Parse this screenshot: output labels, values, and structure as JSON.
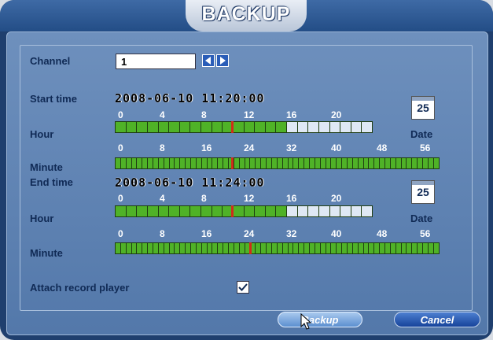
{
  "window": {
    "title": "BACKUP"
  },
  "channel": {
    "label": "Channel",
    "value": "1"
  },
  "start": {
    "label": "Start time",
    "datetime": "2008-06-10  11:20:00",
    "hour_label": "Hour",
    "minute_label": "Minute",
    "date_label": "Date",
    "date_day": "25",
    "hour_value": 11,
    "minute_value": 20
  },
  "end": {
    "label": "End time",
    "datetime": "2008-06-10  11:24:00",
    "hour_label": "Hour",
    "minute_label": "Minute",
    "date_label": "Date",
    "date_day": "25",
    "hour_value": 11,
    "minute_value": 24
  },
  "hour_scale": [
    "0",
    "4",
    "8",
    "12",
    "16",
    "20"
  ],
  "minute_scale": [
    "0",
    "8",
    "16",
    "24",
    "32",
    "40",
    "48",
    "56"
  ],
  "hour_segments_total": 24,
  "hour_segments_recorded": 16,
  "minute_segments_total": 60,
  "attach": {
    "label": "Attach record player",
    "checked": true
  },
  "buttons": {
    "backup": "Backup",
    "cancel": "Cancel"
  },
  "colors": {
    "recorded": "#4fb227",
    "empty": "#dfe8f4",
    "marker": "#d02c19",
    "label": "#102a55"
  }
}
